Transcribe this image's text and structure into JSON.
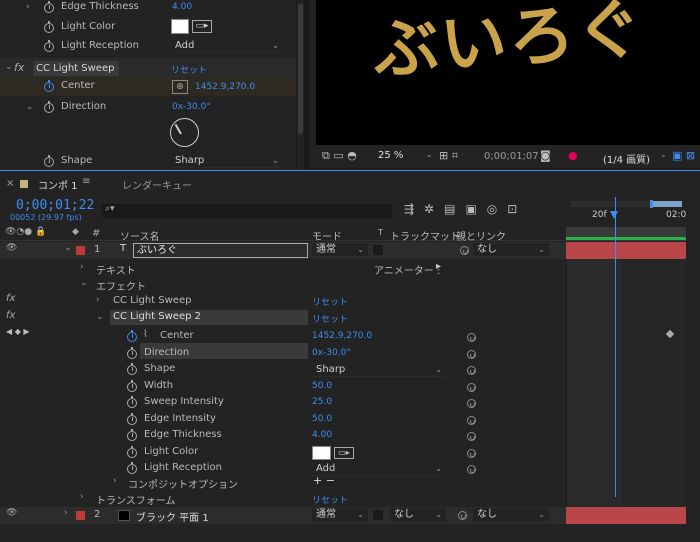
{
  "ec_panel": {
    "edge_thickness_label": "Edge Thickness",
    "edge_thickness_value": "4.00",
    "light_color_label": "Light Color",
    "light_reception_label": "Light Reception",
    "light_reception_value": "Add",
    "fx_icon": "fx",
    "effect_name": "CC Light Sweep 2",
    "reset": "リセット",
    "center_label": "Center",
    "center_value": "1452.9,270.0",
    "direction_label": "Direction",
    "direction_value": "0x-30.0°",
    "shape_label": "Shape",
    "shape_value": "Sharp"
  },
  "viewer": {
    "title_text": "ぶいろぐ",
    "zoom": "25 %",
    "timecode": "0;00;01;07",
    "resolution": "(1/4 画質)"
  },
  "timeline": {
    "tab_comp": "コンポ 1",
    "tab_render": "レンダーキュー",
    "timecode": "0;00;01;22",
    "frames": "00052 (29.97 fps)",
    "search_placeholder": "",
    "ruler_20f": "20f",
    "ruler_02": "02:0",
    "col_hash": "#",
    "col_source": "ソース名",
    "col_mode": "モード",
    "col_t": "T",
    "col_trackmatte": "トラックマット",
    "col_parent": "親とリンク",
    "layer1": {
      "num": "1",
      "type_icon": "T",
      "name": "ぶいろぐ",
      "mode": "通常",
      "parent": "なし",
      "color": "#c0393b"
    },
    "text_group": "テキスト",
    "animator": "アニメーター :",
    "effects_group": "エフェクト",
    "fx1": "CC Light Sweep",
    "fx1_reset": "リセット",
    "fx2": "CC Light Sweep 2",
    "fx2_reset": "リセット",
    "props": [
      {
        "label": "Center",
        "value": "1452.9,270.0"
      },
      {
        "label": "Direction",
        "value": "0x-30.0°"
      },
      {
        "label": "Shape",
        "value": "Sharp"
      },
      {
        "label": "Width",
        "value": "50.0"
      },
      {
        "label": "Sweep Intensity",
        "value": "25.0"
      },
      {
        "label": "Edge Intensity",
        "value": "50.0"
      },
      {
        "label": "Edge Thickness",
        "value": "4.00"
      },
      {
        "label": "Light Color",
        "value": ""
      },
      {
        "label": "Light Reception",
        "value": "Add"
      }
    ],
    "composite_options": "コンポジットオプション",
    "composite_buttons": "+ −",
    "transform_group": "トランスフォーム",
    "transform_reset": "リセット",
    "layer2": {
      "num": "2",
      "name": "ブラック 平面 1",
      "mode": "通常",
      "trackmatte": "なし",
      "parent": "なし",
      "color": "#c0393b"
    }
  },
  "colors": {
    "accent_blue": "#3d8ef0",
    "layer_red": "#c0393b",
    "gold": "#c9a24a"
  }
}
